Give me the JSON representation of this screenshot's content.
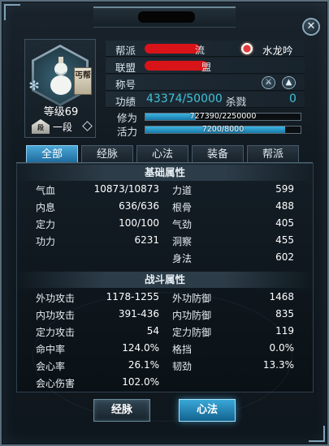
{
  "profile": {
    "level_label": "等级69",
    "faction_badge": "丐帮",
    "rank_label": "一段",
    "rank_icon_text": "段"
  },
  "info": {
    "sect_label": "帮派",
    "sect_value_visible": "流",
    "sect_name": "水龙吟",
    "alliance_label": "联盟",
    "alliance_value_visible": "盟",
    "title_label": "称号",
    "merit_label": "功绩",
    "merit_value": "43374/50000",
    "kills_label": "杀戮",
    "kills_value": "0",
    "cultivation_label": "修为",
    "cultivation_text": "727390/2250000",
    "cultivation_fraction": 0.323,
    "vitality_label": "活力",
    "vitality_text": "7200/8000",
    "vitality_fraction": 0.9
  },
  "tabs": [
    {
      "label": "全部"
    },
    {
      "label": "经脉"
    },
    {
      "label": "心法"
    },
    {
      "label": "装备"
    },
    {
      "label": "帮派"
    }
  ],
  "basic": {
    "header": "基础属性",
    "left": [
      {
        "label": "气血",
        "value": "10873/10873"
      },
      {
        "label": "内息",
        "value": "636/636"
      },
      {
        "label": "定力",
        "value": "100/100"
      },
      {
        "label": "功力",
        "value": "6231"
      }
    ],
    "right": [
      {
        "label": "力道",
        "value": "599"
      },
      {
        "label": "根骨",
        "value": "488"
      },
      {
        "label": "气劲",
        "value": "405"
      },
      {
        "label": "洞察",
        "value": "455"
      },
      {
        "label": "身法",
        "value": "602"
      }
    ]
  },
  "combat": {
    "header": "战斗属性",
    "left": [
      {
        "label": "外功攻击",
        "value": "1178-1255"
      },
      {
        "label": "内功攻击",
        "value": "391-436"
      },
      {
        "label": "定力攻击",
        "value": "54"
      },
      {
        "label": "命中率",
        "value": "124.0%"
      },
      {
        "label": "会心率",
        "value": "26.1%"
      },
      {
        "label": "会心伤害",
        "value": "102.0%"
      }
    ],
    "right": [
      {
        "label": "外功防御",
        "value": "1468"
      },
      {
        "label": "内功防御",
        "value": "835"
      },
      {
        "label": "定力防御",
        "value": "119"
      },
      {
        "label": "格挡",
        "value": "0.0%"
      },
      {
        "label": "韧劲",
        "value": "13.3%"
      }
    ]
  },
  "buttons": {
    "meridian": "经脉",
    "mental": "心法"
  },
  "icons": {
    "close": "close-icon",
    "title_1": "sword-icon",
    "title_2": "hat-icon"
  },
  "colors": {
    "accent": "#40c3d8",
    "tab_active": "#2f8fc4",
    "bar_fill": "#2a9fd2"
  }
}
